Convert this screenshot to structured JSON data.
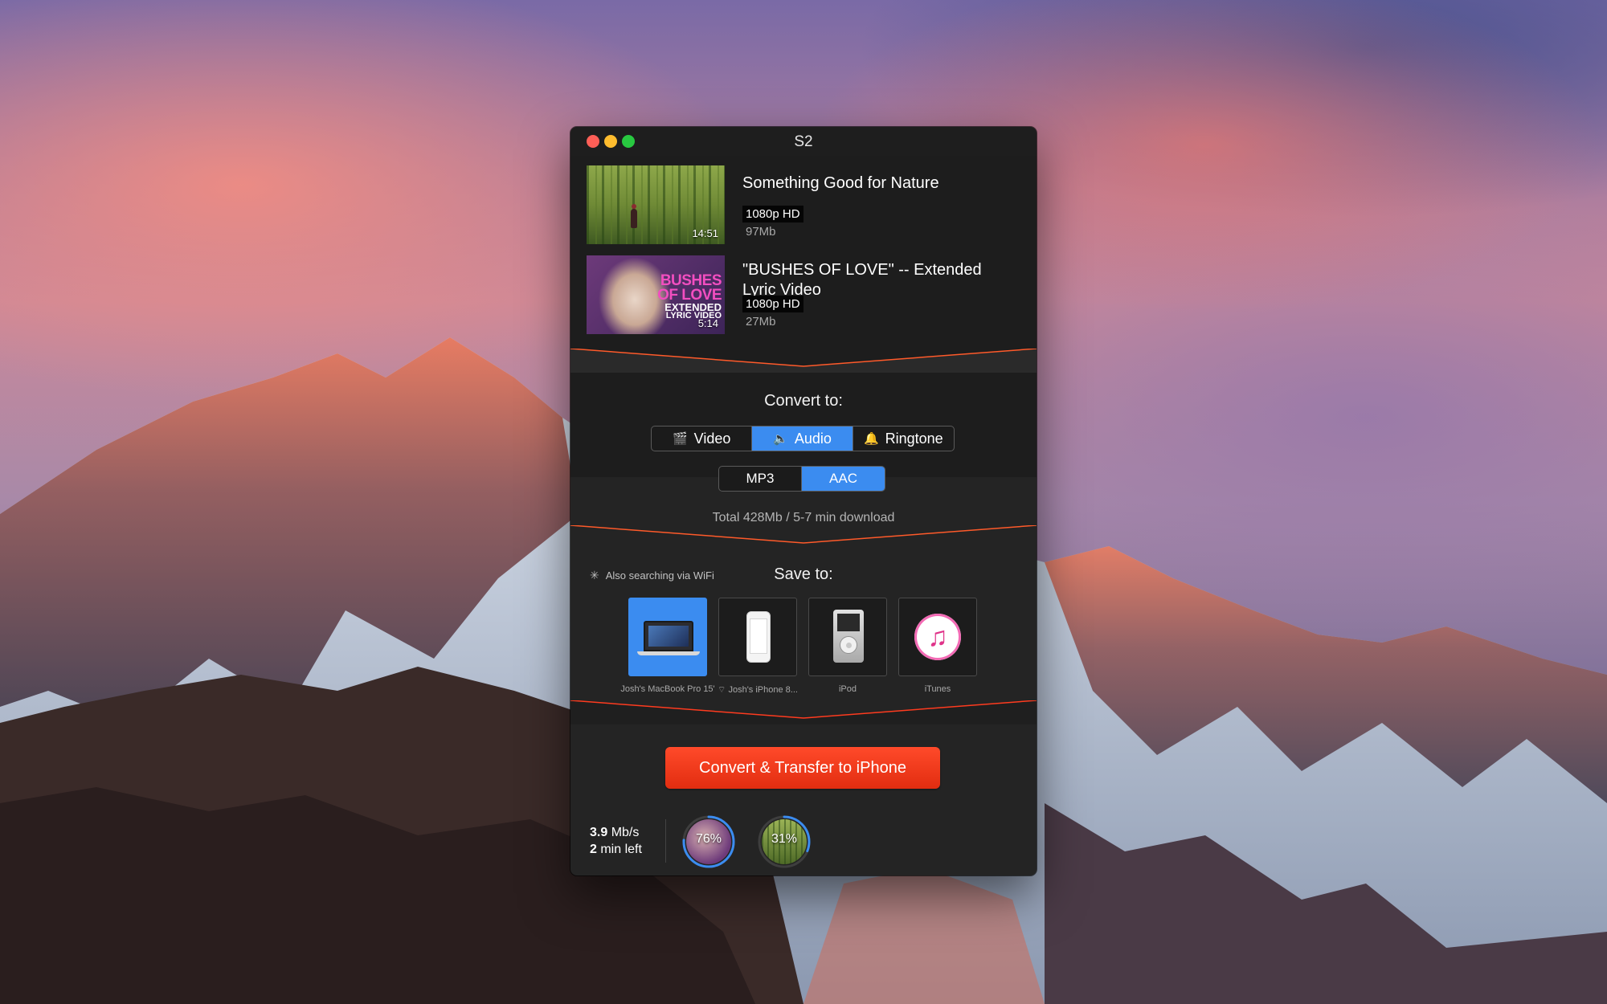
{
  "window": {
    "title": "S2"
  },
  "queue": {
    "items": [
      {
        "title": "Something Good for Nature",
        "duration": "14:51",
        "quality": "1080p HD",
        "size": "97Mb"
      },
      {
        "title": "\"BUSHES OF LOVE\" -- Extended Lyric Video",
        "duration": "5:14",
        "quality": "1080p HD",
        "size": "27Mb",
        "thumb_text": [
          "BUSHES",
          "OF LOVE",
          "EXTENDED",
          "LYRIC VIDEO"
        ]
      }
    ]
  },
  "convert": {
    "title": "Convert to:",
    "types": [
      {
        "label": "Video",
        "icon": "clapperboard-icon",
        "glyph": "🎬",
        "active": false
      },
      {
        "label": "Audio",
        "icon": "speaker-icon",
        "glyph": "🔈",
        "active": true
      },
      {
        "label": "Ringtone",
        "icon": "bell-icon",
        "glyph": "🔔",
        "active": false
      }
    ],
    "formats": [
      {
        "label": "MP3",
        "active": false
      },
      {
        "label": "AAC",
        "active": true
      }
    ],
    "total": "Total 428Mb / 5-7 min download"
  },
  "save": {
    "title": "Save to:",
    "wifi_search": "Also searching via WiFi",
    "devices": [
      {
        "label": "Josh's MacBook Pro 15'",
        "icon": "laptop-icon",
        "active": true
      },
      {
        "label": "Josh's iPhone 8...",
        "icon": "iphone-icon",
        "active": false,
        "wifi": true
      },
      {
        "label": "iPod",
        "icon": "ipod-icon",
        "active": false
      },
      {
        "label": "iTunes",
        "icon": "itunes-icon",
        "active": false
      }
    ]
  },
  "action": {
    "label": "Convert & Transfer to iPhone"
  },
  "status": {
    "speed_value": "3.9",
    "speed_unit": " Mb/s",
    "time_value": "2",
    "time_unit": " min left"
  },
  "progress": [
    {
      "label": "76%",
      "fraction": 0.76
    },
    {
      "label": "31%",
      "fraction": 0.31
    }
  ],
  "colors": {
    "accent_blue": "#3b8cf0",
    "action_red": "#ff3b1f",
    "divider_orange": "#ff5a2a"
  }
}
